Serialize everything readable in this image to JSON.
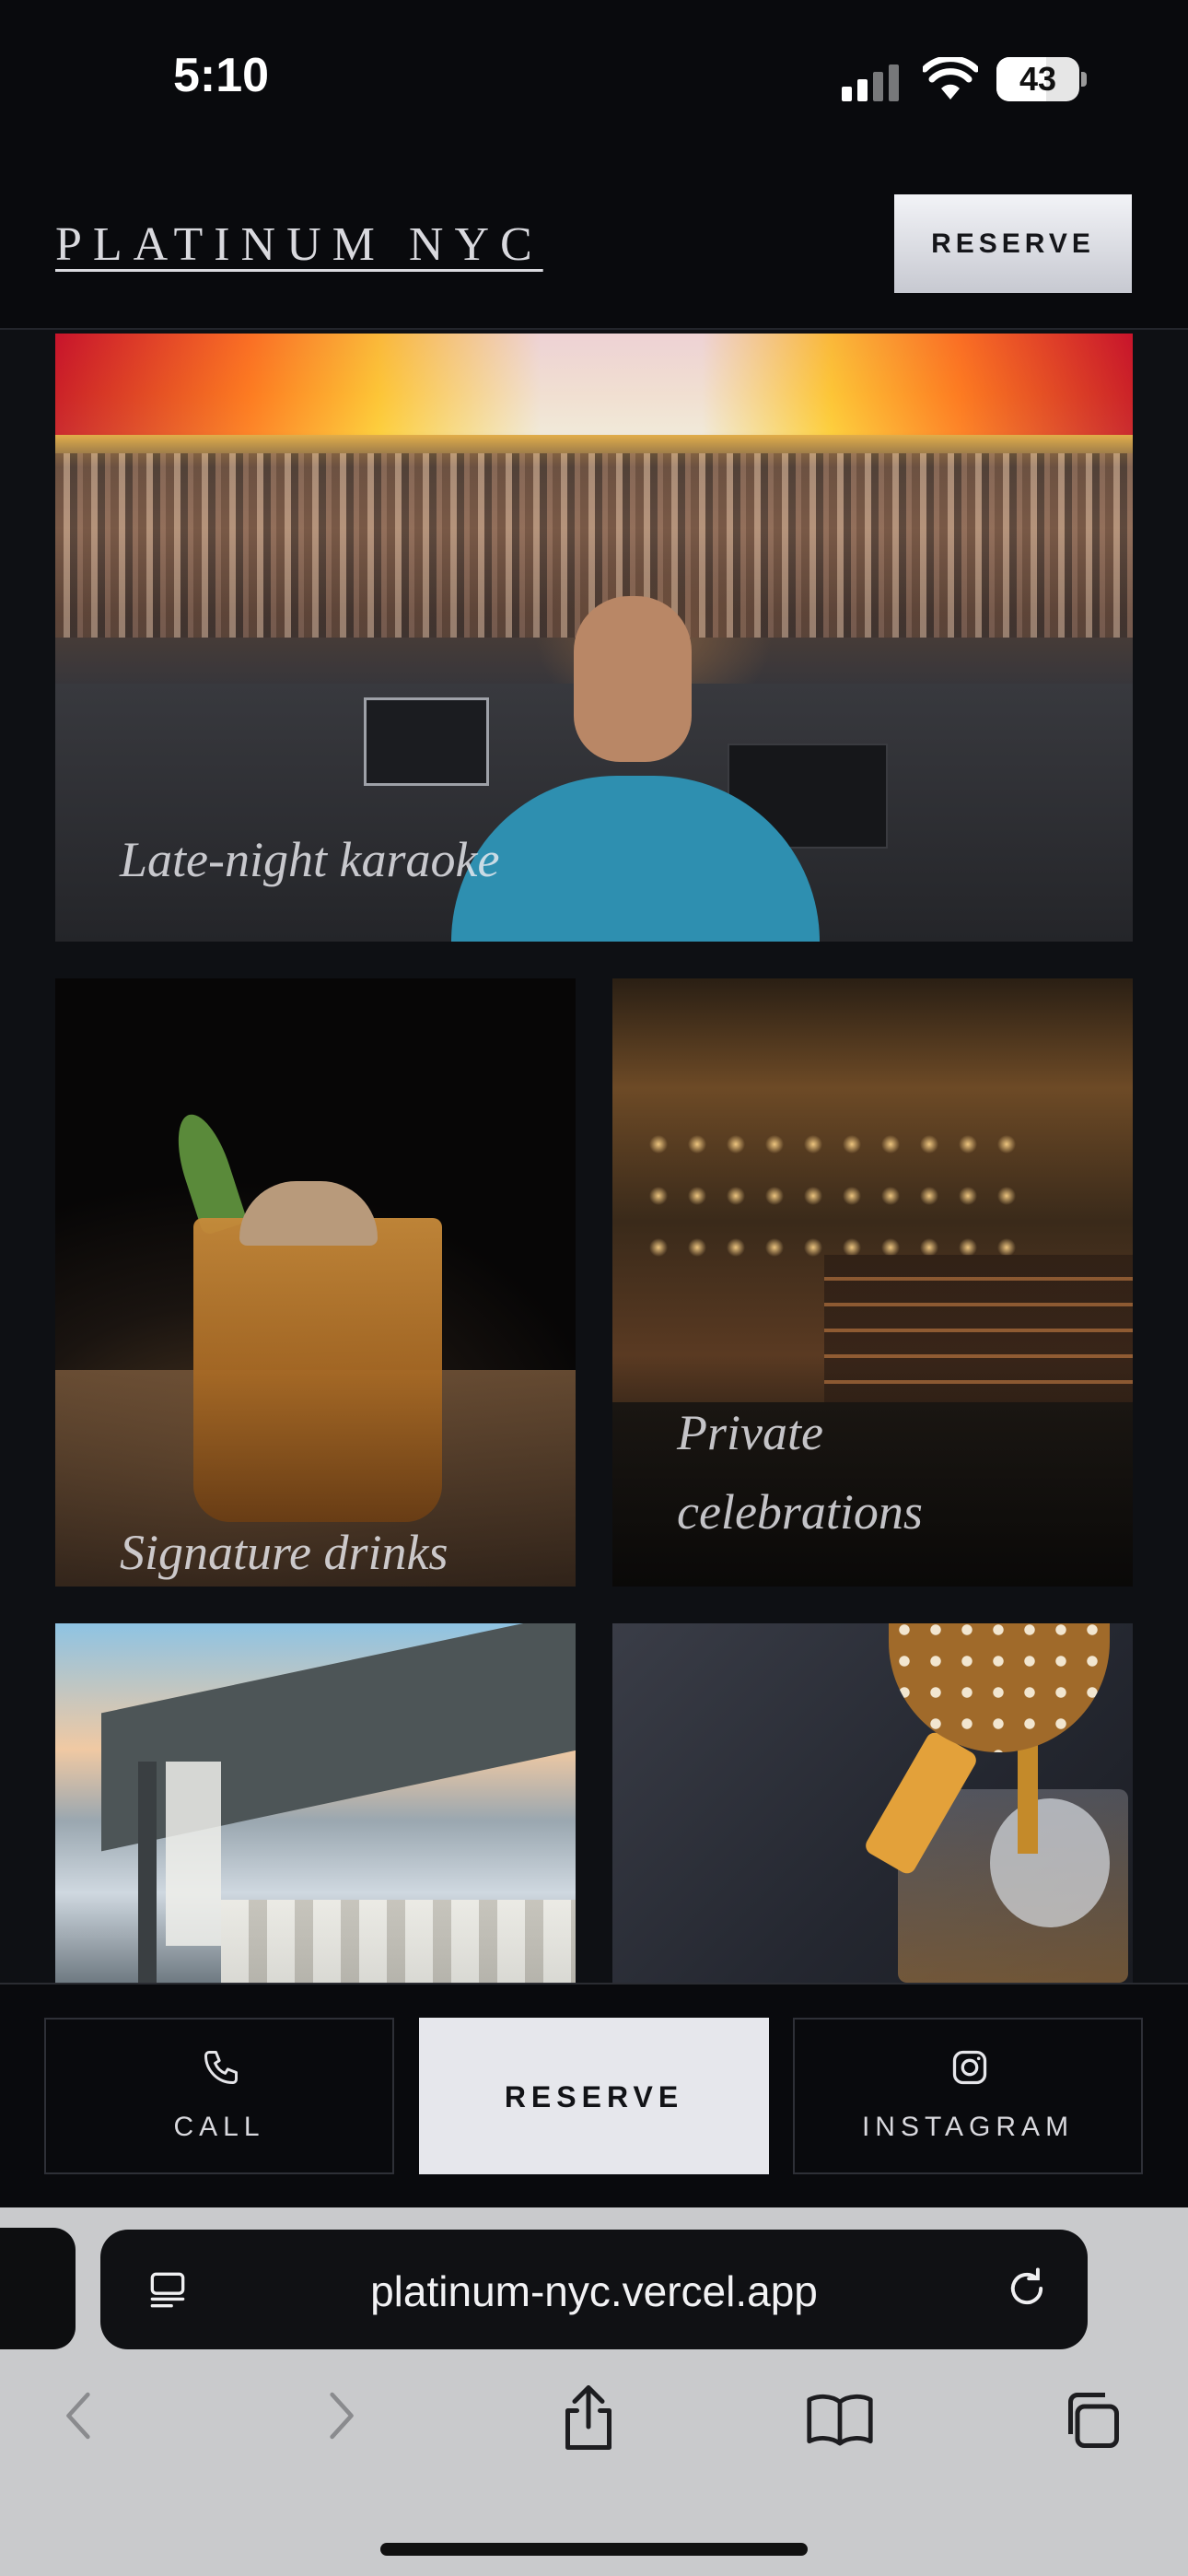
{
  "status_bar": {
    "time": "5:10",
    "battery": "43"
  },
  "header": {
    "logo": "PLATINUM NYC",
    "reserve_label": "RESERVE"
  },
  "gallery": [
    {
      "caption": "Late-night karaoke",
      "scene": "dj-festival-crowd"
    },
    {
      "caption": "Signature drinks",
      "scene": "cocktail-glass"
    },
    {
      "caption": "Private celebrations",
      "scene": "bar-with-pendant-lights"
    },
    {
      "caption": "",
      "scene": "waterfront-terrace"
    },
    {
      "caption": "",
      "scene": "cocktail-pour"
    }
  ],
  "action_bar": {
    "call_label": "CALL",
    "reserve_label": "RESERVE",
    "instagram_label": "INSTAGRAM"
  },
  "browser": {
    "url": "platinum-nyc.vercel.app"
  },
  "icons": [
    "phone-icon",
    "instagram-icon",
    "reader-icon",
    "reload-icon",
    "back-icon",
    "forward-icon",
    "share-icon",
    "bookmarks-icon",
    "tabs-icon"
  ],
  "colors": {
    "background": "#0b0c0f",
    "accent_button": "#e6e7ec",
    "safari_bar": "#c9cacc"
  }
}
